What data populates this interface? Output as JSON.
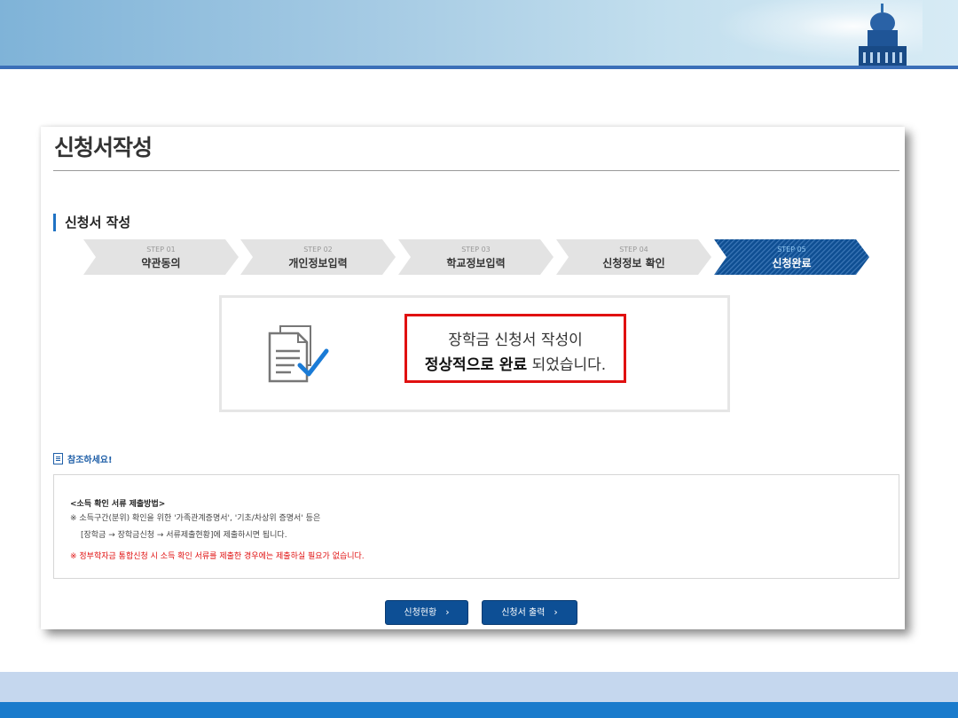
{
  "page": {
    "title": "신청서작성",
    "section_title": "신청서 작성"
  },
  "steps": [
    {
      "num": "STEP 01",
      "name": "약관동의",
      "state": "done"
    },
    {
      "num": "STEP 02",
      "name": "개인정보입력",
      "state": "done"
    },
    {
      "num": "STEP 03",
      "name": "학교정보입력",
      "state": "done"
    },
    {
      "num": "STEP 04",
      "name": "신청정보 확인",
      "state": "done"
    },
    {
      "num": "STEP 05",
      "name": "신청완료",
      "state": "active"
    }
  ],
  "completion": {
    "line1": "장학금 신청서 작성이",
    "line2_bold": "정상적으로 완료",
    "line2_rest": " 되었습니다."
  },
  "notice": {
    "heading": "참조하세요!",
    "title": "<소득 확인 서류 제출방법>",
    "line1": "※ 소득구간(분위) 확인을 위한 '가족관계증명서', '기초/차상위 증명서' 등은",
    "line2": "[장학금 → 장학금신청 → 서류제출현황]에 제출하시면 됩니다.",
    "warning": "※ 정부학자금 통합신청 시 소득 확인 서류를 제출한 경우에는 제출하실 필요가 없습니다."
  },
  "buttons": {
    "status": "신청현황",
    "print": "신청서 출력"
  },
  "colors": {
    "accent": "#1f72c4",
    "button": "#0d4f95",
    "active_step": "#0f4f93",
    "highlight_border": "#e01010",
    "banner_line": "#3b6fb8",
    "footer_bar": "#1a7bcc"
  }
}
